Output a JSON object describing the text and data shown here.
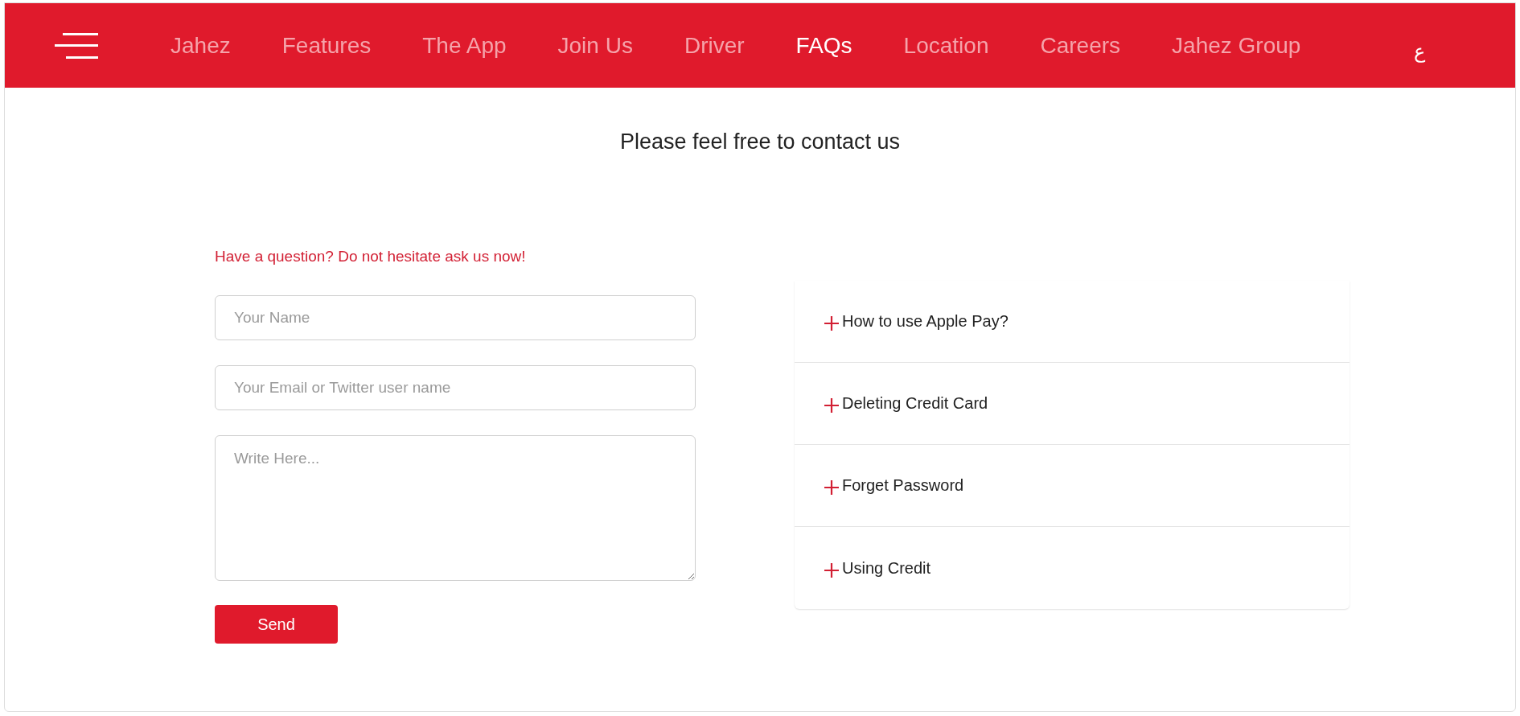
{
  "nav": {
    "items": [
      {
        "label": "Jahez",
        "selected": false
      },
      {
        "label": "Features",
        "selected": false
      },
      {
        "label": "The App",
        "selected": false
      },
      {
        "label": "Join Us",
        "selected": false
      },
      {
        "label": "Driver",
        "selected": false
      },
      {
        "label": "FAQs",
        "selected": true
      },
      {
        "label": "Location",
        "selected": false
      },
      {
        "label": "Careers",
        "selected": false
      },
      {
        "label": "Jahez Group",
        "selected": false
      }
    ],
    "language": "ع"
  },
  "subtitle": "Please feel free to contact us",
  "form": {
    "prompt": "Have a question? Do not hesitate ask us now!",
    "fields": [
      {
        "kind": "input",
        "placeholder": "Your Name"
      },
      {
        "kind": "input",
        "placeholder": "Your Email or Twitter user name"
      },
      {
        "kind": "textarea",
        "placeholder": "Write Here..."
      }
    ],
    "submit": "Send"
  },
  "faqs": [
    {
      "question": "How to use Apple Pay?",
      "expanded": false
    },
    {
      "question": "Deleting Credit Card",
      "expanded": false
    },
    {
      "question": "Forget Password",
      "expanded": false
    },
    {
      "question": "Using Credit",
      "expanded": false
    }
  ]
}
